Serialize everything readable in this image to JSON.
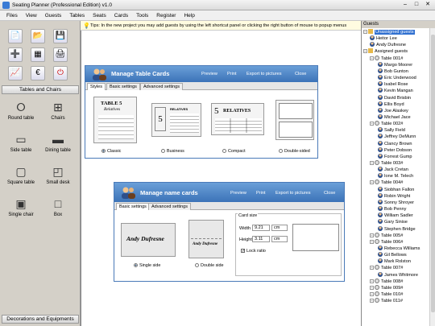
{
  "window": {
    "title": "Seating Planner (Professional Edition) v1.0"
  },
  "menu": [
    "Files",
    "View",
    "Guests",
    "Tables",
    "Seats",
    "Cards",
    "Tools",
    "Register",
    "Help"
  ],
  "tip": "Tips: In the new project you may add guests by using the left shortcut panel or clicking the right button of mouse to popup menus",
  "left": {
    "section_tables": "Tables and Chairs",
    "section_decor": "Decorations and Equipments",
    "shapes": [
      "Round table",
      "Chairs",
      "Side table",
      "Dining table",
      "Square table",
      "Small desk",
      "Single chair",
      "Box"
    ]
  },
  "table_cards": {
    "title": "Manage Table Cards",
    "nav": [
      "Preview",
      "Print",
      "Export to pictures",
      "Close"
    ],
    "tabs": [
      "Styles",
      "Basic settings",
      "Advanced settings"
    ],
    "styles": [
      "Classic",
      "Business",
      "Compact",
      "Double-sided"
    ],
    "sample1_title": "TABLE 5",
    "sample1_sub": "Relatives",
    "sample_table": "5",
    "sample_rel": "RELATIVES"
  },
  "name_cards": {
    "title": "Manage name cards",
    "nav": [
      "Preview",
      "Print",
      "Export to pictures",
      "Close"
    ],
    "tabs": [
      "Basic settings",
      "Advanced settings"
    ],
    "styles": [
      "Single side",
      "Double side"
    ],
    "sample_name": "Andy Dufresne",
    "card_size": "Card size",
    "width_label": "Width",
    "width_value": "9.21",
    "width_unit": "cm",
    "height_label": "Height",
    "height_value": "3.11",
    "height_unit": "cm",
    "lock": "Lock ratio"
  },
  "guests": {
    "header": "Guests",
    "tree": [
      {
        "label": "Unassigned guests",
        "level": 1,
        "selected": true,
        "type": "folder"
      },
      {
        "label": "Heitor Lee",
        "level": 2,
        "type": "person"
      },
      {
        "label": "Andy Dufresne",
        "level": 2,
        "type": "person"
      },
      {
        "label": "Assigned guests",
        "level": 1,
        "type": "folder"
      },
      {
        "label": "Table 001#",
        "level": 2,
        "type": "table"
      },
      {
        "label": "Margo Moorer",
        "level": 3,
        "type": "person"
      },
      {
        "label": "Bob Gunton",
        "level": 3,
        "type": "person"
      },
      {
        "label": "Eric Underwood",
        "level": 3,
        "type": "person"
      },
      {
        "label": "Isabel Rose",
        "level": 3,
        "type": "person"
      },
      {
        "label": "Kevin Mangan",
        "level": 3,
        "type": "person"
      },
      {
        "label": "David Brisbin",
        "level": 3,
        "type": "person"
      },
      {
        "label": "Ellis Boyd",
        "level": 3,
        "type": "person"
      },
      {
        "label": "Joe Alaskey",
        "level": 3,
        "type": "person"
      },
      {
        "label": "Michael Jace",
        "level": 3,
        "type": "person"
      },
      {
        "label": "Table 002#",
        "level": 2,
        "type": "table"
      },
      {
        "label": "Sally Field",
        "level": 3,
        "type": "person"
      },
      {
        "label": "Jeffrey DeMunn",
        "level": 3,
        "type": "person"
      },
      {
        "label": "Clancy Brown",
        "level": 3,
        "type": "person"
      },
      {
        "label": "Peter Dobson",
        "level": 3,
        "type": "person"
      },
      {
        "label": "Forrest Gump",
        "level": 3,
        "type": "person"
      },
      {
        "label": "Table 003#",
        "level": 2,
        "type": "table"
      },
      {
        "label": "Jack Cretan",
        "level": 3,
        "type": "person"
      },
      {
        "label": "Ione M. Telech",
        "level": 3,
        "type": "person"
      },
      {
        "label": "Table 004#",
        "level": 2,
        "type": "table"
      },
      {
        "label": "Siobhan Fallon",
        "level": 3,
        "type": "person"
      },
      {
        "label": "Robin Wright",
        "level": 3,
        "type": "person"
      },
      {
        "label": "Sonny Shroyer",
        "level": 3,
        "type": "person"
      },
      {
        "label": "Bob Penny",
        "level": 3,
        "type": "person"
      },
      {
        "label": "William Sadler",
        "level": 3,
        "type": "person"
      },
      {
        "label": "Gary Sinise",
        "level": 3,
        "type": "person"
      },
      {
        "label": "Stephen Bridge",
        "level": 3,
        "type": "person"
      },
      {
        "label": "Table 005#",
        "level": 2,
        "type": "table"
      },
      {
        "label": "Table 006#",
        "level": 2,
        "type": "table"
      },
      {
        "label": "Rebecca Williams",
        "level": 3,
        "type": "person"
      },
      {
        "label": "Gil Bellows",
        "level": 3,
        "type": "person"
      },
      {
        "label": "Mark Rolston",
        "level": 3,
        "type": "person"
      },
      {
        "label": "Table 007#",
        "level": 2,
        "type": "table"
      },
      {
        "label": "James Whitmore",
        "level": 3,
        "type": "person"
      },
      {
        "label": "Table 008#",
        "level": 2,
        "type": "table"
      },
      {
        "label": "Table 009#",
        "level": 2,
        "type": "table"
      },
      {
        "label": "Table 010#",
        "level": 2,
        "type": "table"
      },
      {
        "label": "Table 011#",
        "level": 2,
        "type": "table"
      }
    ]
  },
  "colors": {
    "header_blue": "#3c73b8",
    "selection": "#2f6fd0"
  }
}
